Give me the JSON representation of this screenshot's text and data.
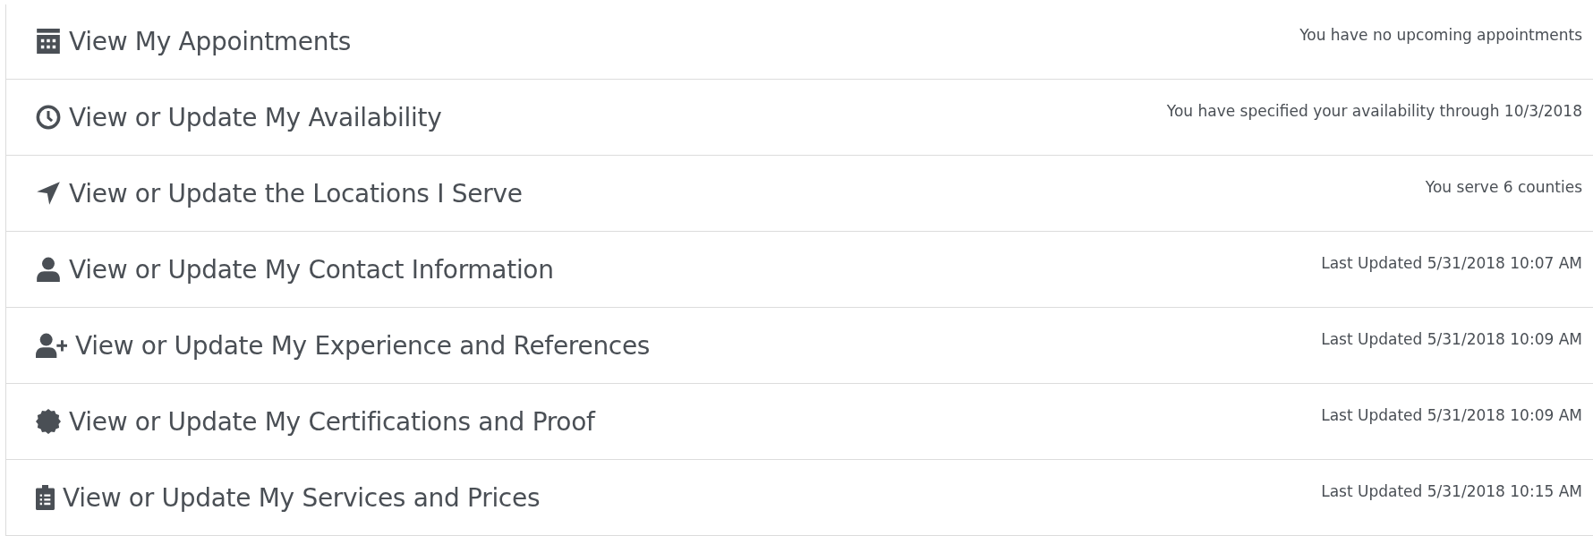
{
  "items": [
    {
      "title": "View My Appointments",
      "status": "You have no upcoming appointments"
    },
    {
      "title": "View or Update My Availability",
      "status": "You have specified your availability through 10/3/2018"
    },
    {
      "title": "View or Update the Locations I Serve",
      "status": "You serve 6 counties"
    },
    {
      "title": "View or Update My Contact Information",
      "status": "Last Updated 5/31/2018 10:07 AM"
    },
    {
      "title": "View or Update My Experience and References",
      "status": "Last Updated 5/31/2018 10:09 AM"
    },
    {
      "title": "View or Update My Certifications and Proof",
      "status": "Last Updated 5/31/2018 10:09 AM"
    },
    {
      "title": "View or Update My Services and Prices",
      "status": "Last Updated 5/31/2018 10:15 AM"
    }
  ]
}
